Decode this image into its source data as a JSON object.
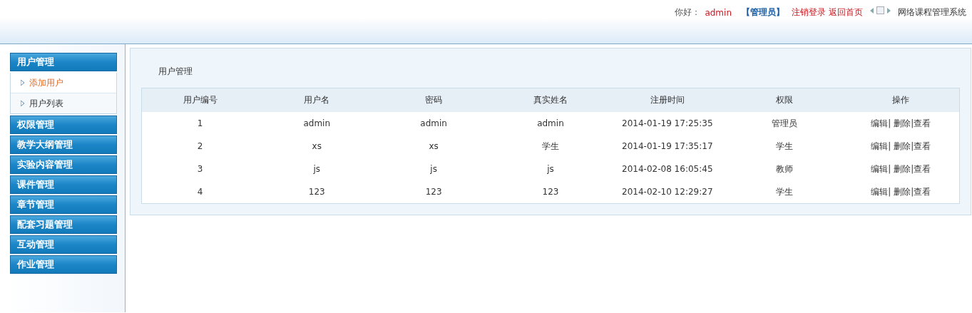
{
  "header": {
    "greeting": "你好：",
    "user": "admin",
    "role": "【管理员】",
    "links": [
      "注销登录",
      "返回首页"
    ],
    "system_name": "网络课程管理系统"
  },
  "sidebar": {
    "groups": [
      {
        "label": "用户管理",
        "items": [
          {
            "label": "添加用户",
            "selected": true
          },
          {
            "label": "用户列表",
            "selected": false
          }
        ]
      },
      {
        "label": "权限管理"
      },
      {
        "label": "教学大纲管理"
      },
      {
        "label": "实验内容管理"
      },
      {
        "label": "课件管理"
      },
      {
        "label": "章节管理"
      },
      {
        "label": "配套习题管理"
      },
      {
        "label": "互动管理"
      },
      {
        "label": "作业管理"
      }
    ]
  },
  "content": {
    "title": "用户管理",
    "table": {
      "columns": [
        "用户编号",
        "用户名",
        "密码",
        "真实姓名",
        "注册时间",
        "权限",
        "操作"
      ],
      "action_separator": "|",
      "rows": [
        {
          "cells": [
            "1",
            "admin",
            "admin",
            "admin",
            "2014-01-19 17:25:35",
            "管理员"
          ],
          "actions": [
            "编辑",
            "删除",
            "查看"
          ]
        },
        {
          "cells": [
            "2",
            "xs",
            "xs",
            "学生",
            "2014-01-19 17:35:17",
            "学生"
          ],
          "actions": [
            "编辑",
            "删除",
            "查看"
          ]
        },
        {
          "cells": [
            "3",
            "js",
            "js",
            "js",
            "2014-02-08 16:05:45",
            "教师"
          ],
          "actions": [
            "编辑",
            "删除",
            "查看"
          ]
        },
        {
          "cells": [
            "4",
            "123",
            "123",
            "123",
            "2014-02-10 12:29:27",
            "学生"
          ],
          "actions": [
            "编辑",
            "删除",
            "查看"
          ]
        }
      ]
    }
  }
}
